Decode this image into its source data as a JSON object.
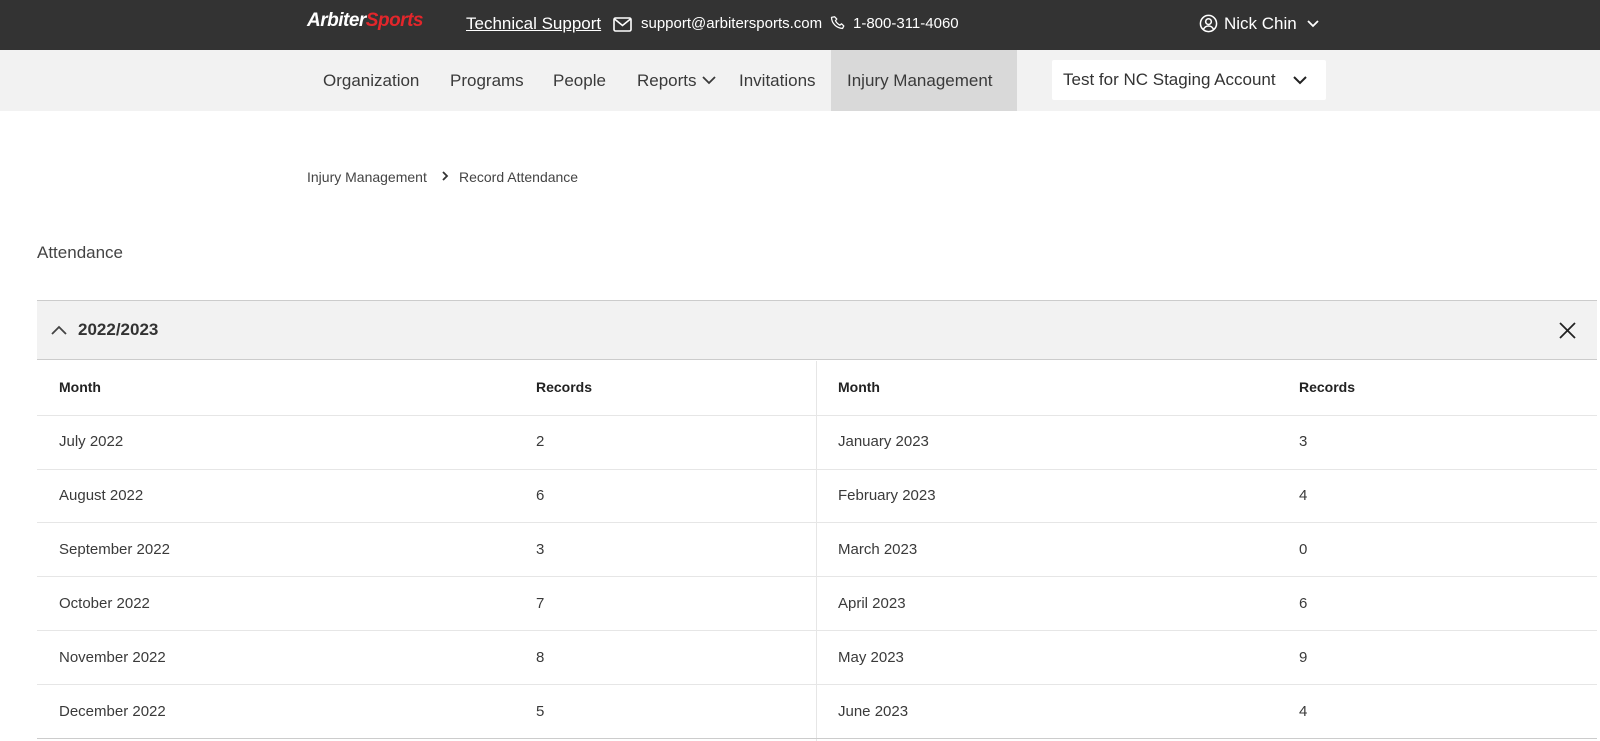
{
  "header": {
    "logo_part1": "Arbiter",
    "logo_part2": "Sports",
    "tech_support": "Technical Support",
    "email": "support@arbitersports.com",
    "phone": "1-800-311-4060",
    "user_name": "Nick Chin"
  },
  "nav": {
    "items": [
      "Organization",
      "Programs",
      "People",
      "Reports",
      "Invitations",
      "Injury Management"
    ],
    "active": "Injury Management",
    "account": "Test for NC Staging Account"
  },
  "breadcrumb": [
    "Injury Management",
    "Record Attendance"
  ],
  "page_title": "Attendance",
  "panel": {
    "season": "2022/2023",
    "columns": [
      "Month",
      "Records",
      "Month",
      "Records"
    ],
    "left_rows": [
      {
        "month": "July 2022",
        "records": "2"
      },
      {
        "month": "August 2022",
        "records": "6"
      },
      {
        "month": "September 2022",
        "records": "3"
      },
      {
        "month": "October 2022",
        "records": "7"
      },
      {
        "month": "November 2022",
        "records": "8"
      },
      {
        "month": "December 2022",
        "records": "5"
      }
    ],
    "right_rows": [
      {
        "month": "January 2023",
        "records": "3"
      },
      {
        "month": "February 2023",
        "records": "4"
      },
      {
        "month": "March 2023",
        "records": "0"
      },
      {
        "month": "April 2023",
        "records": "6"
      },
      {
        "month": "May 2023",
        "records": "9"
      },
      {
        "month": "June 2023",
        "records": "4"
      }
    ]
  },
  "colors": {
    "topbar": "#333333",
    "brand_red": "#e3262b",
    "nav_bg": "#f2f2f2",
    "nav_active": "#d9d9d9"
  }
}
